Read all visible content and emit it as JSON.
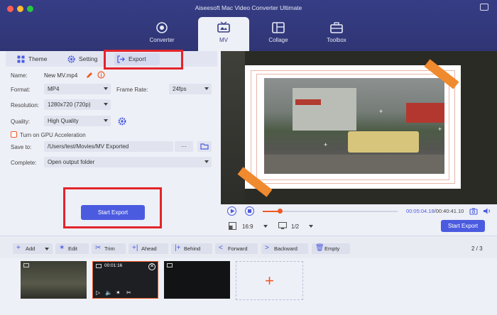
{
  "app": {
    "title": "Aiseesoft Mac Video Converter Ultimate"
  },
  "nav": [
    {
      "label": "Converter",
      "icon": "converter-icon"
    },
    {
      "label": "MV",
      "icon": "mv-icon",
      "active": true
    },
    {
      "label": "Collage",
      "icon": "collage-icon"
    },
    {
      "label": "Toolbox",
      "icon": "toolbox-icon"
    }
  ],
  "tabs": {
    "theme": "Theme",
    "setting": "Setting",
    "export": "Export"
  },
  "form": {
    "name_label": "Name:",
    "name_value": "New MV.mp4",
    "format_label": "Format:",
    "format_value": "MP4",
    "frame_rate_label": "Frame Rate:",
    "frame_rate_value": "24fps",
    "resolution_label": "Resolution:",
    "resolution_value": "1280x720 (720p)",
    "quality_label": "Quality:",
    "quality_value": "High Quality",
    "gpu_label": "Turn on GPU Acceleration",
    "save_to_label": "Save to:",
    "save_to_value": "/Users/test/Movies/MV Exported",
    "browse_label": "···",
    "complete_label": "Complete:",
    "complete_value": "Open output folder",
    "start_export": "Start Export"
  },
  "player": {
    "current_time": "00:05:04.18",
    "total_time": "/00:40:41.10",
    "aspect": "16:9",
    "split": "1/2",
    "start_export": "Start Export",
    "progress_fraction": 0.13
  },
  "toolbar": {
    "add": "Add",
    "edit": "Edit",
    "trim": "Trim",
    "ahead": "Ahead",
    "behind": "Behind",
    "forward": "Forward",
    "backward": "Backward",
    "empty": "Empty",
    "pager": "2 / 3"
  },
  "timeline": {
    "clip_time": "00:01:16"
  },
  "colors": {
    "accent": "#4b5be0",
    "orange": "#f05a23",
    "highlight": "#e3242b",
    "nav": "#363d85"
  }
}
